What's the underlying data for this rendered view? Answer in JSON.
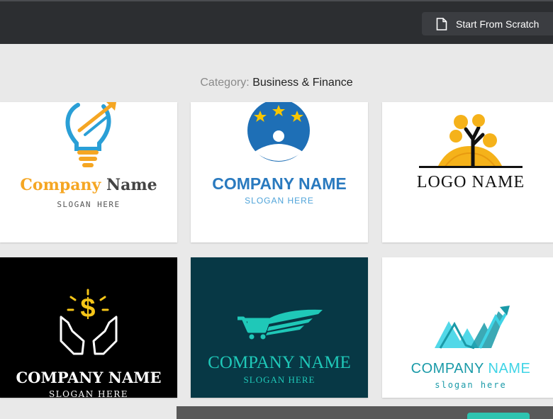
{
  "toolbar": {
    "start_label": "Start From Scratch",
    "start_icon": "document-icon"
  },
  "category": {
    "label": "Category:",
    "value": "Business & Finance"
  },
  "logos": [
    {
      "title_part1": "Company",
      "title_part2": "Name",
      "slogan": "SLOGAN HERE",
      "icon": "lightbulb-arrow-icon",
      "colors": {
        "accent": "#f5a623",
        "text": "#444444",
        "icon": "#2a9fd6"
      }
    },
    {
      "title": "COMPANY NAME",
      "slogan": "SLOGAN HERE",
      "icon": "stars-person-circle-icon",
      "colors": {
        "title": "#2a7abf",
        "slogan": "#4ea3d9"
      }
    },
    {
      "title": "LOGO NAME",
      "icon": "tree-sun-icon",
      "colors": {
        "title": "#111111",
        "sun": "#f5b21a"
      }
    },
    {
      "title": "COMPANY NAME",
      "slogan": "SLOGAN HERE",
      "icon": "hands-dollar-icon",
      "colors": {
        "bg": "#000000",
        "title": "#ffffff",
        "icon": "#f5c518"
      }
    },
    {
      "title": "COMPANY NAME",
      "slogan": "SLOGAN HERE",
      "icon": "winged-cart-icon",
      "colors": {
        "bg": "#073845",
        "title": "#1fc8b8"
      }
    },
    {
      "title_part1": "COMPANY",
      "title_part2": "NAME",
      "slogan": "slogan here",
      "icon": "rising-arrow-icon",
      "colors": {
        "part1": "#1a9aa8",
        "part2": "#3fd4e6"
      }
    }
  ]
}
